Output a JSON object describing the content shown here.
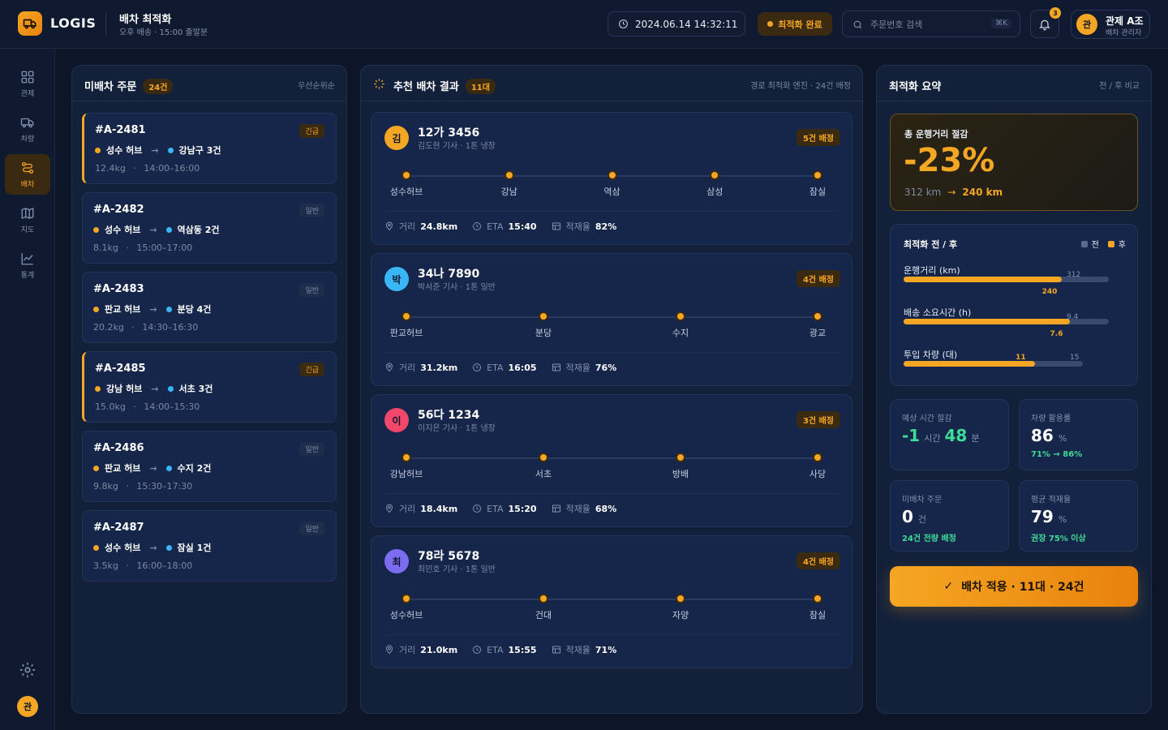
{
  "app": {
    "brand": "LOGIS",
    "page_title": "배차 최적화",
    "page_subtitle": "오후 배송 · 15:00 출발분",
    "datetime": "2024.06.14 14:32:11",
    "status": "최적화 완료",
    "search_placeholder": "주문번호 검색",
    "search_shortcut": "⌘K",
    "notif_count": "3",
    "user_initial": "관",
    "user_name": "관제 A조",
    "user_role": "배차 관리자"
  },
  "nav": [
    {
      "label": "관제",
      "icon": "dashboard-icon"
    },
    {
      "label": "차량",
      "icon": "truck-icon"
    },
    {
      "label": "배차",
      "icon": "route-icon",
      "active": true
    },
    {
      "label": "지도",
      "icon": "map-icon"
    },
    {
      "label": "통계",
      "icon": "chart-icon"
    }
  ],
  "nav_bottom_initial": "관",
  "orders": {
    "title": "미배차 주문",
    "count": "24건",
    "sort": "우선순위순",
    "items": [
      {
        "id": "#A-2481",
        "tag": "긴급",
        "urgent": true,
        "from": "성수 허브",
        "to": "강남구 3건",
        "weight": "12.4kg",
        "window": "14:00–16:00"
      },
      {
        "id": "#A-2482",
        "tag": "일반",
        "urgent": false,
        "from": "성수 허브",
        "to": "역삼동 2건",
        "weight": "8.1kg",
        "window": "15:00–17:00"
      },
      {
        "id": "#A-2483",
        "tag": "일반",
        "urgent": false,
        "from": "판교 허브",
        "to": "분당 4건",
        "weight": "20.2kg",
        "window": "14:30–16:30"
      },
      {
        "id": "#A-2485",
        "tag": "긴급",
        "urgent": true,
        "from": "강남 허브",
        "to": "서초 3건",
        "weight": "15.0kg",
        "window": "14:00–15:30"
      },
      {
        "id": "#A-2486",
        "tag": "일반",
        "urgent": false,
        "from": "판교 허브",
        "to": "수지 2건",
        "weight": "9.8kg",
        "window": "15:30–17:30"
      },
      {
        "id": "#A-2487",
        "tag": "일반",
        "urgent": false,
        "from": "성수 허브",
        "to": "잠실 1건",
        "weight": "3.5kg",
        "window": "16:00–18:00"
      }
    ]
  },
  "results": {
    "title": "추천 배차 결과",
    "count": "11대",
    "engine": "경로 최적화 엔진 · 24건 배정",
    "vehicles": [
      {
        "initial": "김",
        "color": "#f5a623",
        "plate": "12가 3456",
        "driver": "김도현 기사 · 1톤 냉장",
        "assigned": "5건 배정",
        "stops": [
          "성수허브",
          "강남",
          "역삼",
          "삼성",
          "잠실"
        ],
        "distance": "24.8km",
        "eta": "15:40",
        "load": "82%"
      },
      {
        "initial": "박",
        "color": "#38b6f5",
        "plate": "34나 7890",
        "driver": "박서준 기사 · 1톤 일반",
        "assigned": "4건 배정",
        "stops": [
          "판교허브",
          "분당",
          "수지",
          "광교"
        ],
        "distance": "31.2km",
        "eta": "16:05",
        "load": "76%"
      },
      {
        "initial": "이",
        "color": "#f0476b",
        "plate": "56다 1234",
        "driver": "이지은 기사 · 1톤 냉장",
        "assigned": "3건 배정",
        "stops": [
          "강남허브",
          "서초",
          "방배",
          "사당"
        ],
        "distance": "18.4km",
        "eta": "15:20",
        "load": "68%"
      },
      {
        "initial": "최",
        "color": "#7b6cf0",
        "plate": "78라 5678",
        "driver": "최민호 기사 · 1톤 일반",
        "assigned": "4건 배정",
        "stops": [
          "성수허브",
          "건대",
          "자양",
          "잠실"
        ],
        "distance": "21.0km",
        "eta": "15:55",
        "load": "71%"
      }
    ],
    "labels": {
      "distance": "거리",
      "eta": "ETA",
      "load": "적재율"
    }
  },
  "summary": {
    "title": "최적화 요약",
    "compare": "전 / 후 비교",
    "saving": {
      "label": "총 운행거리 절감",
      "value": "-23%",
      "before": "312 km",
      "after": "240 km"
    },
    "compare_card": {
      "title": "최적화 전 / 후",
      "legend_before": "전",
      "legend_after": "후",
      "rows": [
        {
          "label": "운행거리 (km)",
          "before": 312,
          "after": 240,
          "before_text": "312",
          "after_text": "240"
        },
        {
          "label": "배송 소요시간 (h)",
          "before": 9.4,
          "after": 7.6,
          "before_text": "9.4",
          "after_text": "7.6"
        },
        {
          "label": "투입 차량 (대)",
          "before": 15,
          "after": 11,
          "before_text": "15",
          "after_text": "11"
        }
      ]
    },
    "metrics": [
      {
        "label": "예상 시간 절감",
        "value": "-1",
        "unit": "시간",
        "value2": "48",
        "unit2": "분",
        "sub": ""
      },
      {
        "label": "차량 활용률",
        "value": "86",
        "unit": "%",
        "sub": "71% → 86%"
      },
      {
        "label": "미배차 주문",
        "value": "0",
        "unit": "건",
        "sub": "24건 전량 배정"
      },
      {
        "label": "평균 적재율",
        "value": "79",
        "unit": "%",
        "sub": "권장 75% 이상"
      }
    ],
    "apply_label": "배차 적용 · 11대 · 24건"
  }
}
